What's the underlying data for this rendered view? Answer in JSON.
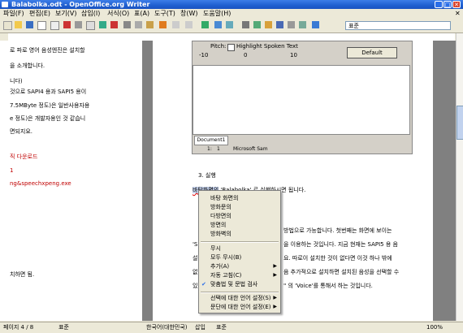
{
  "window": {
    "title": "Balabolka.odt - OpenOffice.org Writer"
  },
  "menubar": [
    "파일(F)",
    "편집(E)",
    "보기(V)",
    "삽입(I)",
    "서식(O)",
    "표(A)",
    "도구(T)",
    "창(W)",
    "도움말(H)"
  ],
  "toolbar": {
    "style_value": "표준"
  },
  "doc": {
    "page1_lines": [
      "로 파로 영어 음성엔진은 설치할",
      "을 소개합니다.",
      "니다)",
      "것으로 SAPI4 용과 SAPI5 용이",
      "7.5MByte 정도)은 일반사용자용",
      "e 정도)은 개발자용인 것 같습니",
      "면되지요.",
      "직 다운로드",
      "1",
      "ng&speechxpeng.exe",
      "치하면 됨."
    ],
    "embed": {
      "pitch_label": "Pitch:",
      "pitch_min": "-10",
      "pitch_zero": "0",
      "pitch_max": "10",
      "checkbox_label": "Highlight Spoken Text",
      "default_button": "Default",
      "tab_label": "Document1",
      "status_pos": "1:",
      "status_num": "1",
      "status_voice": "Microsoft Sam"
    },
    "page2": {
      "heading": "3. 실행",
      "run_line_word": "바탕화면의",
      "run_line_rest": "'Balabolka' 로 실행하시면 됩니다.",
      "line_a": "방법으로 가능합니다. 첫번째는 화면에 보이는",
      "line_b_pre": "'S",
      "line_b": "을 이용하는 것입니다. 지금 현재는 SAPI5 용 음",
      "line_c_pre": "설",
      "line_c": "요. 따로이 설치한 것이 없다면 이것 하나 밖에",
      "line_d_pre": "없",
      "line_d": "음 추가적으로 설치하면 설치된 음성을 선택할 수",
      "line_e_pre": "있",
      "line_e": "\" 의 'Voice'를 통해서 하는 것입니다."
    }
  },
  "context_menu": {
    "suggestions": [
      "바탕 화면의",
      "방화문의",
      "다방면의",
      "방면의",
      "방화벽의"
    ],
    "items": [
      {
        "label": "무시",
        "submenu": false
      },
      {
        "label": "모두 무시(B)",
        "submenu": false
      },
      {
        "label": "추가(A)",
        "submenu": true
      },
      {
        "label": "자동 고침(C)",
        "submenu": true
      },
      {
        "label": "맞춤법 및 문법 검사",
        "submenu": false
      }
    ],
    "language_items": [
      {
        "label": "선택에 대한 언어 설정(S)",
        "submenu": true
      },
      {
        "label": "문단에 대한 언어 설정(E)",
        "submenu": true
      }
    ]
  },
  "statusbar": {
    "page": "페이지 4 / 8",
    "style": "표준",
    "language": "한국어(대한민국)",
    "mode": "삽입",
    "selection": "표준",
    "zoom": "100%"
  }
}
